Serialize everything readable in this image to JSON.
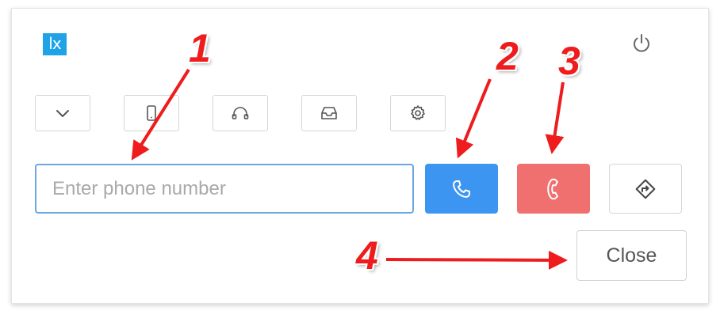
{
  "logo": {
    "text": "lx",
    "color": "#1fa3e6"
  },
  "header": {
    "power_icon": "power-icon"
  },
  "toolbar": {
    "buttons": [
      {
        "icon": "chevron-down-icon"
      },
      {
        "icon": "mobile-phone-icon"
      },
      {
        "icon": "headset-icon"
      },
      {
        "icon": "inbox-icon"
      },
      {
        "icon": "gear-icon"
      }
    ]
  },
  "dial": {
    "placeholder": "Enter phone number",
    "value": "",
    "call_icon": "phone-call-icon",
    "hangup_icon": "phone-hangup-icon",
    "transfer_icon": "transfer-icon",
    "call_color": "#3d95f2",
    "hangup_color": "#f07070"
  },
  "footer": {
    "close_label": "Close"
  },
  "annotations": {
    "callouts": [
      "1",
      "2",
      "3",
      "4"
    ],
    "color": "#ee1c1c"
  }
}
